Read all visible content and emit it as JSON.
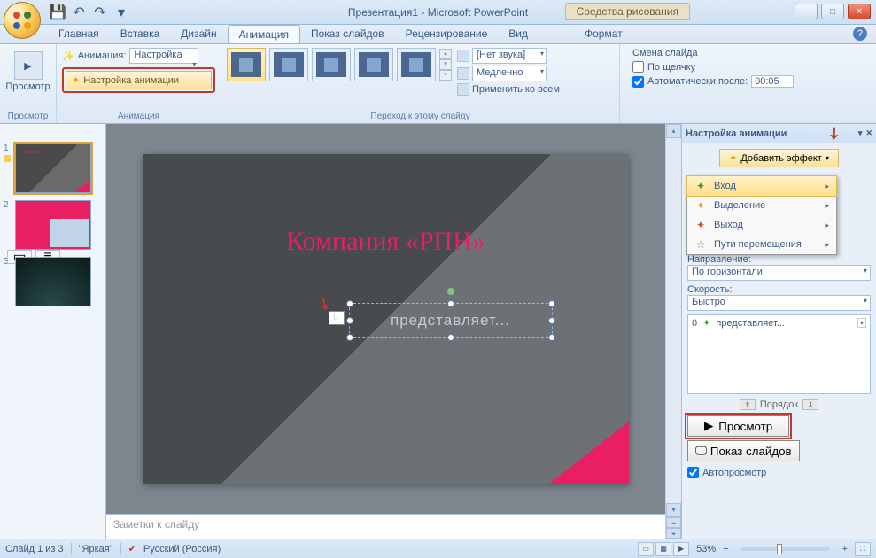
{
  "title": "Презентация1 - Microsoft PowerPoint",
  "context_tab": "Средства рисования",
  "tabs": [
    "Главная",
    "Вставка",
    "Дизайн",
    "Анимация",
    "Показ слайдов",
    "Рецензирование",
    "Вид",
    "Формат"
  ],
  "active_tab": 3,
  "ribbon": {
    "preview": {
      "label": "Просмотр",
      "group": "Просмотр"
    },
    "animation": {
      "label": "Анимация:",
      "combo": "Настройка ...",
      "button": "Настройка анимации",
      "group": "Анимация"
    },
    "transition": {
      "sound_label": "[Нет звука]",
      "speed_label": "Медленно",
      "apply_all": "Применить ко всем",
      "group": "Переход к этому слайду"
    },
    "advance": {
      "title": "Смена слайда",
      "on_click": "По щелчку",
      "auto_after": "Автоматически после:",
      "time": "00:05"
    }
  },
  "slides": [
    {
      "num": "1"
    },
    {
      "num": "2"
    },
    {
      "num": "3"
    }
  ],
  "canvas": {
    "title": "Компания «РПН»",
    "subtitle": "представляет...",
    "anim_index": "0"
  },
  "notes_placeholder": "Заметки к слайду",
  "taskpane": {
    "title": "Настройка анимации",
    "add_effect": "Добавить эффект",
    "menu": {
      "entry": "Вход",
      "emphasis": "Выделение",
      "exit": "Выход",
      "motion": "Пути перемещения"
    },
    "direction_label": "Направление:",
    "direction_value": "По горизонтали",
    "speed_label": "Скорость:",
    "speed_value": "Быстро",
    "effect_item": {
      "index": "0",
      "name": "представляет..."
    },
    "reorder": "Порядок",
    "play": "Просмотр",
    "slideshow": "Показ слайдов",
    "autopreview": "Автопросмотр"
  },
  "status": {
    "slide": "Слайд 1 из 3",
    "theme": "\"Яркая\"",
    "lang": "Русский (Россия)",
    "zoom": "53%"
  }
}
